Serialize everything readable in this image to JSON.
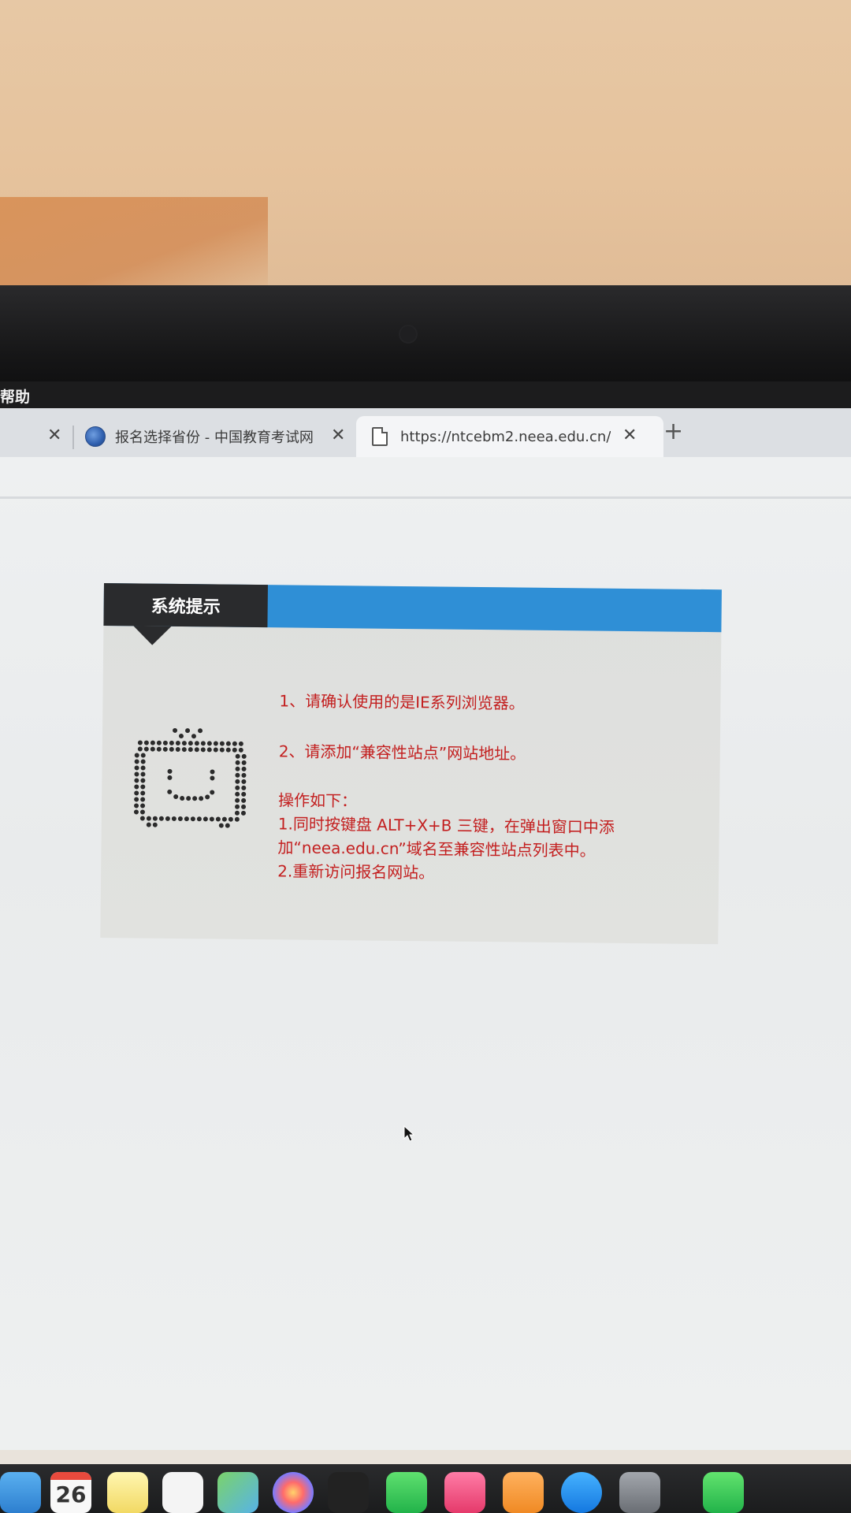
{
  "menubar": {
    "help_label": "帮助"
  },
  "tabs": [
    {
      "label": "",
      "active": false
    },
    {
      "label": "报名选择省份 - 中国教育考试网",
      "active": false,
      "icon": "globe-icon"
    },
    {
      "label": "https://ntcebm2.neea.edu.cn/",
      "active": true,
      "icon": "document-icon"
    }
  ],
  "new_tab_label": "+",
  "dialog": {
    "title": "系统提示",
    "lines": [
      "1、请确认使用的是IE系列浏览器。",
      "2、请添加“兼容性站点”网站地址。",
      "操作如下：",
      "1.同时按键盘 ALT+X+B 三键，在弹出窗口中添",
      "加“neea.edu.cn”域名至兼容性站点列表中。",
      "2.重新访问报名网站。"
    ],
    "icon": "tv-dot-icon"
  },
  "dock": {
    "calendar_day": "26",
    "items": [
      "finder-icon",
      "calendar-icon",
      "notes-icon",
      "reminders-icon",
      "maps-icon",
      "photos-icon",
      "terminal-icon",
      "facetime-icon",
      "music-icon",
      "books-icon",
      "app-store-icon",
      "settings-icon",
      "messages-icon"
    ]
  },
  "colors": {
    "accent_blue": "#2f8fd6",
    "title_box": "#2a2b2d",
    "message_red": "#c31f1f"
  }
}
